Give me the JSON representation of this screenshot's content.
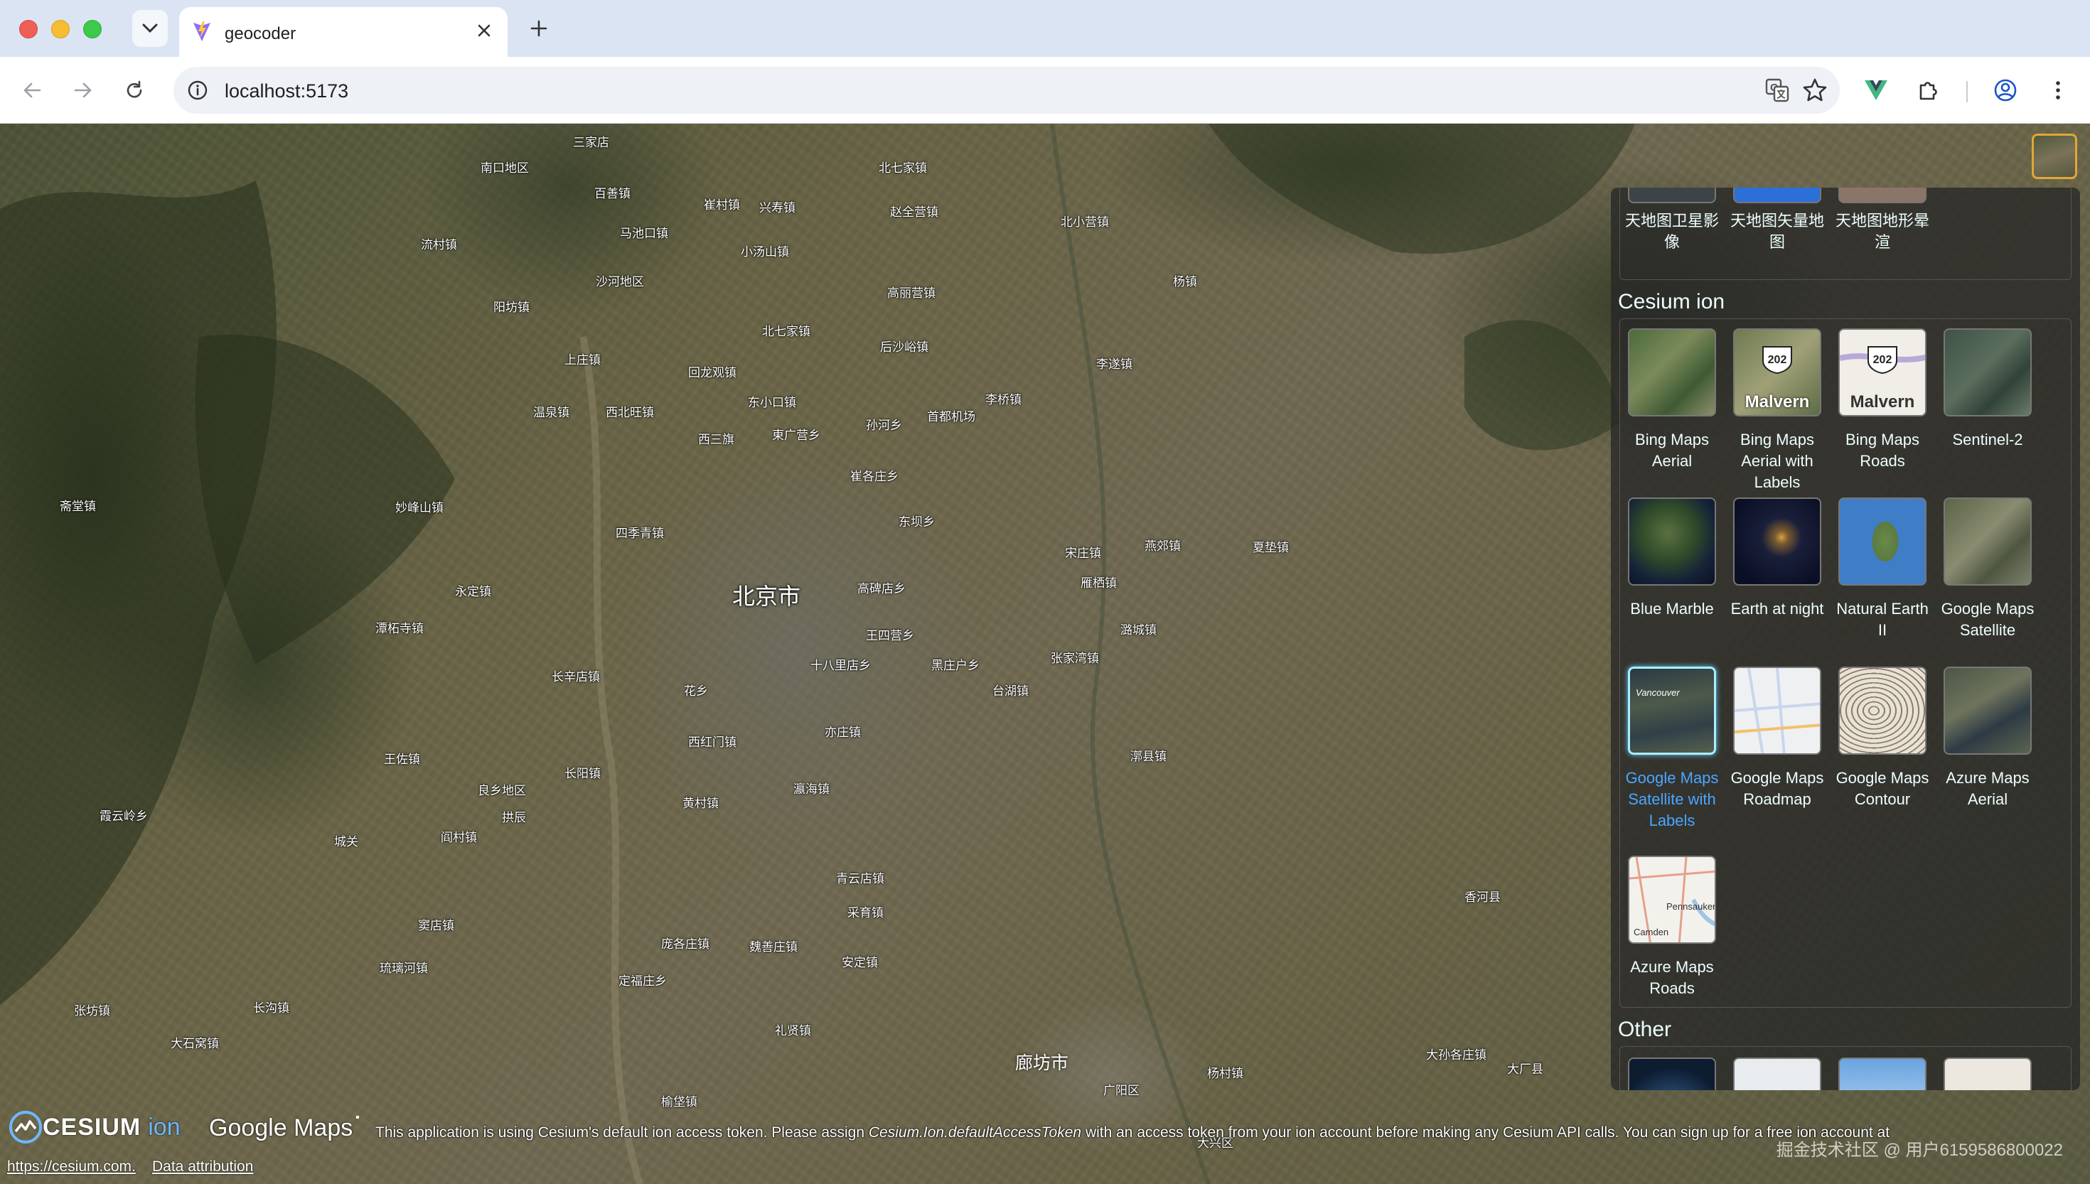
{
  "browser": {
    "tab_title": "geocoder",
    "url": "localhost:5173"
  },
  "map": {
    "city": "北京市",
    "city_secondary": "廊坊市",
    "places": [
      "三家店",
      "南口地区",
      "百善镇",
      "北七家镇",
      "马池口镇",
      "崔村镇",
      "兴寿镇",
      "流村镇",
      "沙河地区",
      "赵全营镇",
      "小汤山镇",
      "北小营镇",
      "阳坊镇",
      "高丽营镇",
      "北七家镇",
      "杨镇",
      "上庄镇",
      "后沙峪镇",
      "回龙观镇",
      "李遂镇",
      "东小口镇",
      "温泉镇",
      "西北旺镇",
      "孙河乡",
      "首都机场",
      "李桥镇",
      "西三旗",
      "東广营乡",
      "崔各庄乡",
      "妙峰山镇",
      "东坝乡",
      "四季青镇",
      "宋庄镇",
      "燕郊镇",
      "夏垫镇",
      "雁栖镇",
      "永定镇",
      "高碑店乡",
      "潭柘寺镇",
      "潞城镇",
      "王四营乡",
      "十八里店乡",
      "黑庄户乡",
      "张家湾镇",
      "长辛店镇",
      "花乡",
      "台湖镇",
      "西红门镇",
      "亦庄镇",
      "漷县镇",
      "王佐镇",
      "良乡地区",
      "长阳镇",
      "瀛海镇",
      "琉璃河镇",
      "黄村镇",
      "拱辰",
      "阎村镇",
      "城关",
      "青云店镇",
      "窦店镇",
      "采育镇",
      "安定镇",
      "魏善庄镇",
      "庞各庄镇",
      "定福庄乡",
      "礼贤镇",
      "大兴区",
      "香河县",
      "大孙各庄镇",
      "张坊镇",
      "长沟镇",
      "大石窝镇",
      "榆垡镇",
      "广阳区",
      "杨村镇",
      "大厂县",
      "霞云岭乡",
      "斋堂镇"
    ],
    "place_labels": [
      [
        "三家店",
        806,
        12
      ],
      [
        "南口地区",
        676,
        48
      ],
      [
        "百善镇",
        836,
        84
      ],
      [
        "北七家镇",
        1236,
        48
      ],
      [
        "马池口镇",
        872,
        140
      ],
      [
        "崔村镇",
        990,
        100
      ],
      [
        "兴寿镇",
        1068,
        104
      ],
      [
        "流村镇",
        592,
        156
      ],
      [
        "沙河地区",
        838,
        208
      ],
      [
        "赵全营镇",
        1252,
        110
      ],
      [
        "小汤山镇",
        1042,
        166
      ],
      [
        "北小营镇",
        1492,
        124
      ],
      [
        "阳坊镇",
        694,
        244
      ],
      [
        "高丽营镇",
        1248,
        224
      ],
      [
        "北七家镇",
        1072,
        278
      ],
      [
        "杨镇",
        1650,
        208
      ],
      [
        "上庄镇",
        794,
        318
      ],
      [
        "后沙峪镇",
        1238,
        300
      ],
      [
        "回龙观镇",
        968,
        336
      ],
      [
        "李遂镇",
        1542,
        324
      ],
      [
        "东小口镇",
        1052,
        378
      ],
      [
        "温泉镇",
        750,
        392
      ],
      [
        "西北旺镇",
        852,
        392
      ],
      [
        "孙河乡",
        1218,
        410
      ],
      [
        "首都机场",
        1304,
        398
      ],
      [
        "李桥镇",
        1386,
        374
      ],
      [
        "西三旗",
        982,
        430
      ],
      [
        "東广营乡",
        1086,
        424
      ],
      [
        "崔各庄乡",
        1196,
        482
      ],
      [
        "妙峰山镇",
        556,
        526
      ],
      [
        "东坝乡",
        1264,
        546
      ],
      [
        "四季青镇",
        866,
        562
      ],
      [
        "宋庄镇",
        1498,
        590
      ],
      [
        "燕郊镇",
        1610,
        580
      ],
      [
        "夏垫镇",
        1762,
        582
      ],
      [
        "雁栖镇",
        1520,
        632
      ],
      [
        "永定镇",
        640,
        644
      ],
      [
        "高碑店乡",
        1206,
        640
      ],
      [
        "潭柘寺镇",
        528,
        696
      ],
      [
        "潞城镇",
        1576,
        698
      ],
      [
        "王四营乡",
        1218,
        706
      ],
      [
        "十八里店乡",
        1140,
        748
      ],
      [
        "黑庄户乡",
        1310,
        748
      ],
      [
        "张家湾镇",
        1478,
        738
      ],
      [
        "长辛店镇",
        776,
        764
      ],
      [
        "花乡",
        962,
        784
      ],
      [
        "台湖镇",
        1396,
        784
      ],
      [
        "西红门镇",
        968,
        856
      ],
      [
        "亦庄镇",
        1160,
        842
      ],
      [
        "漷县镇",
        1590,
        876
      ],
      [
        "王佐镇",
        540,
        880
      ],
      [
        "良乡地区",
        672,
        924
      ],
      [
        "长阳镇",
        794,
        900
      ],
      [
        "瀛海镇",
        1116,
        922
      ],
      [
        "琉璃河镇",
        534,
        1174
      ],
      [
        "黄村镇",
        960,
        942
      ],
      [
        "拱辰",
        706,
        962
      ],
      [
        "阎村镇",
        620,
        990
      ],
      [
        "城关",
        470,
        996
      ],
      [
        "青云店镇",
        1176,
        1048
      ],
      [
        "窦店镇",
        588,
        1114
      ],
      [
        "采育镇",
        1192,
        1096
      ],
      [
        "安定镇",
        1184,
        1166
      ],
      [
        "魏善庄镇",
        1054,
        1144
      ],
      [
        "庞各庄镇",
        930,
        1140
      ],
      [
        "定福庄乡",
        870,
        1192
      ],
      [
        "礼贤镇",
        1090,
        1262
      ],
      [
        "大兴区",
        1684,
        1420
      ],
      [
        "香河县",
        2060,
        1074
      ],
      [
        "大孙各庄镇",
        2006,
        1296
      ],
      [
        "张坊镇",
        104,
        1234
      ],
      [
        "长沟镇",
        356,
        1230
      ],
      [
        "大石窝镇",
        240,
        1280
      ],
      [
        "榆垡镇",
        930,
        1362
      ],
      [
        "广阳区",
        1552,
        1346
      ],
      [
        "杨村镇",
        1698,
        1322
      ],
      [
        "大厂县",
        2120,
        1316
      ],
      [
        "霞云岭乡",
        140,
        960
      ],
      [
        "斋堂镇",
        84,
        524
      ]
    ]
  },
  "picker": {
    "top_items": [
      "天地图卫星影像",
      "天地图矢量地图",
      "天地图地形晕渲"
    ],
    "sections": [
      {
        "title": "Cesium ion",
        "items": [
          {
            "label": "Bing Maps Aerial",
            "thumb": "aerial"
          },
          {
            "label": "Bing Maps Aerial with Labels",
            "thumb": "aerial-labels"
          },
          {
            "label": "Bing Maps Roads",
            "thumb": "roads"
          },
          {
            "label": "Sentinel-2",
            "thumb": "sentinel"
          },
          {
            "label": "Blue Marble",
            "thumb": "blue-marble"
          },
          {
            "label": "Earth at night",
            "thumb": "night"
          },
          {
            "label": "Natural Earth II",
            "thumb": "natural-earth"
          },
          {
            "label": "Google Maps Satellite",
            "thumb": "google-sat"
          },
          {
            "label": "Google Maps Satellite with Labels",
            "thumb": "google-sat-labels",
            "selected": true
          },
          {
            "label": "Google Maps Roadmap",
            "thumb": "google-road"
          },
          {
            "label": "Google Maps Contour",
            "thumb": "google-contour"
          },
          {
            "label": "Azure Maps Aerial",
            "thumb": "azure-aerial"
          },
          {
            "label": "Azure Maps Roads",
            "thumb": "azure-roads"
          }
        ]
      },
      {
        "title": "Other",
        "items": []
      }
    ],
    "thumb_text": {
      "shield_number": "202",
      "malvern": "Malvern",
      "vancouver": "Vancouver",
      "pennsauken": "Pennsauken",
      "camden": "Camden"
    }
  },
  "credits": {
    "cesium_logo": "CESIUM",
    "ion_logo": "ion",
    "google_logo": "Google Maps",
    "token_message_before": "This application is using Cesium's default ion access token. Please assign ",
    "token_message_code": "Cesium.Ion.defaultAccessToken",
    "token_message_after": " with an access token from your ion account before making any Cesium API calls. You can sign up for a free ion account at",
    "cesium_link": "https://cesium.com.",
    "data_attribution": "Data attribution",
    "watermark": "掘金技术社区 @ 用户6159586800022"
  },
  "colors": {
    "titlebar": "#dbe4f3",
    "picker_text": "#edffff",
    "selected_label": "#4aa6ff",
    "layer_button_border": "#e0a836"
  }
}
